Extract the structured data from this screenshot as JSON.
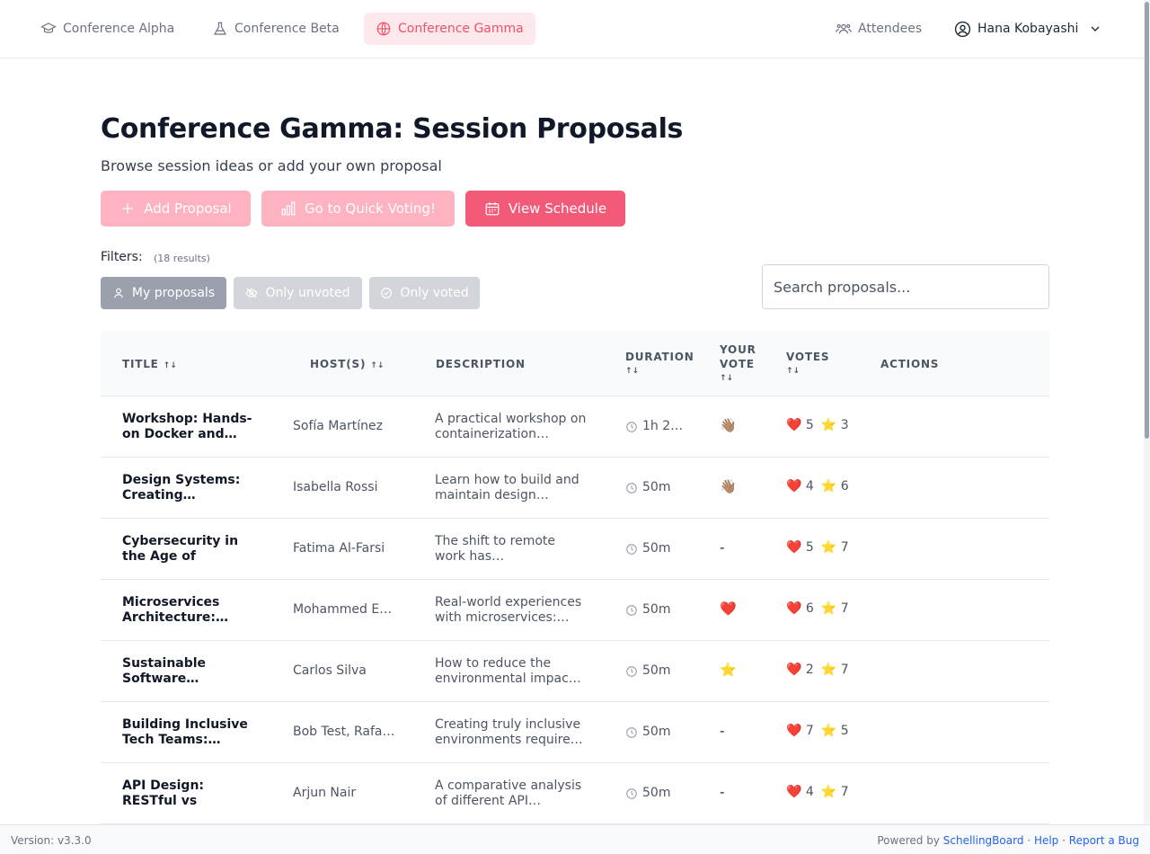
{
  "nav": {
    "tabs": [
      {
        "label": "Conference Alpha",
        "icon": "graduation-cap-icon"
      },
      {
        "label": "Conference Beta",
        "icon": "flask-icon"
      },
      {
        "label": "Conference Gamma",
        "icon": "globe-icon"
      }
    ],
    "active_tab": "Conference Gamma",
    "attendees_label": "Attendees",
    "user_name": "Hana Kobayashi"
  },
  "header": {
    "title": "Conference Gamma: Session Proposals",
    "subtitle": "Browse session ideas or add your own proposal"
  },
  "actions": {
    "add_proposal": "Add Proposal",
    "quick_voting": "Go to Quick Voting!",
    "view_schedule": "View Schedule"
  },
  "filters": {
    "label": "Filters:",
    "results": "(18 results)",
    "my_proposals": "My proposals",
    "only_unvoted": "Only unvoted",
    "only_voted": "Only voted"
  },
  "search": {
    "placeholder": "Search proposals..."
  },
  "table": {
    "headers": {
      "title": "Title",
      "hosts": "Host(s)",
      "description": "Description",
      "duration": "Duration",
      "your_vote_1": "Your",
      "your_vote_2": "Vote",
      "votes": "Votes",
      "actions": "Actions"
    },
    "sort_glyph": "↑↓",
    "rows": [
      {
        "title": "Workshop: Hands-on Docker and…",
        "host": "Sofía Martínez",
        "description": "A practical workshop on containerization…",
        "duration": "1h 2…",
        "my_vote": "👋🏽",
        "hearts": "5",
        "stars": "3"
      },
      {
        "title": "Design Systems: Creating…",
        "host": "Isabella Rossi",
        "description": "Learn how to build and maintain design…",
        "duration": "50m",
        "my_vote": "👋🏽",
        "hearts": "4",
        "stars": "6"
      },
      {
        "title": "Cybersecurity in the Age of Remot…",
        "host": "Fatima Al-Farsi",
        "description": "The shift to remote work has…",
        "duration": "50m",
        "my_vote": "-",
        "hearts": "5",
        "stars": "7"
      },
      {
        "title": "Microservices Architecture:…",
        "host": "Mohammed E…",
        "description": "Real-world experiences with microservices:…",
        "duration": "50m",
        "my_vote": "❤️",
        "hearts": "6",
        "stars": "7"
      },
      {
        "title": "Sustainable Software…",
        "host": "Carlos Silva",
        "description": "How to reduce the environmental impac…",
        "duration": "50m",
        "my_vote": "⭐",
        "hearts": "2",
        "stars": "7"
      },
      {
        "title": "Building Inclusive Tech Teams:…",
        "host": "Bob Test, Rafa…",
        "description": "Creating truly inclusive environments require…",
        "duration": "50m",
        "my_vote": "-",
        "hearts": "7",
        "stars": "5"
      },
      {
        "title": "API Design: RESTful vs GraphQL vs…",
        "host": "Arjun Nair",
        "description": "A comparative analysis of different API…",
        "duration": "50m",
        "my_vote": "-",
        "hearts": "4",
        "stars": "7"
      }
    ]
  },
  "icons": {
    "heart": "❤️",
    "star": "⭐"
  },
  "footer": {
    "version": "Version: v3.3.0",
    "powered_by": "Powered by",
    "brand": "SchellingBoard",
    "sep": "·",
    "help": "Help",
    "report_bug": "Report a Bug"
  },
  "colors": {
    "accent": "#f25a78",
    "accent_light": "#ffb3c1",
    "active_tab_bg": "#fde8ec"
  }
}
